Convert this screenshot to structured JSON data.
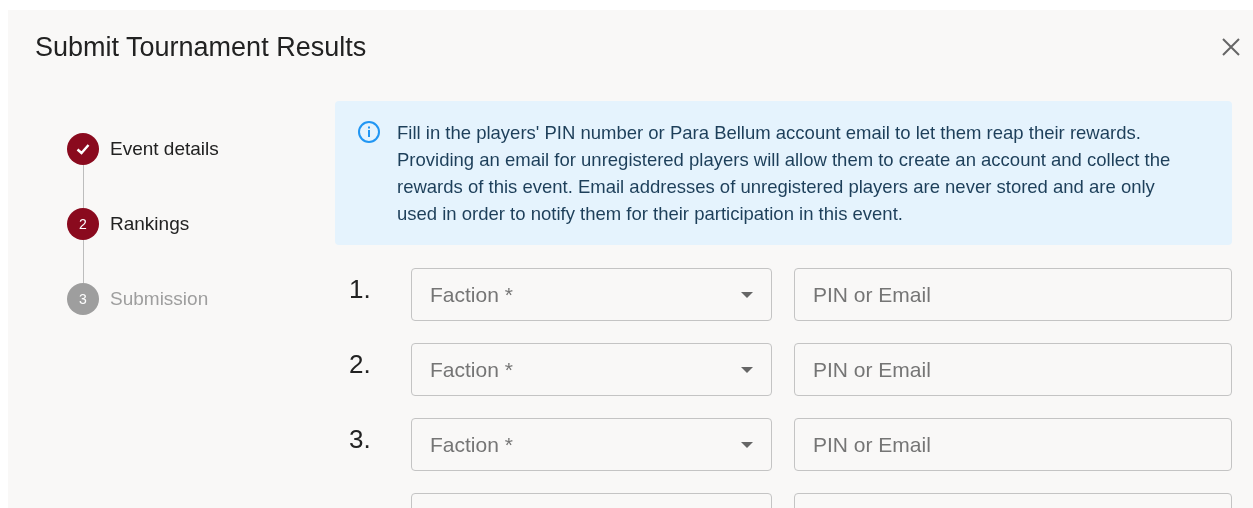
{
  "dialog": {
    "title": "Submit Tournament Results"
  },
  "steps": [
    {
      "label": "Event details",
      "completed": true
    },
    {
      "number": "2",
      "label": "Rankings",
      "completed": false,
      "active": true
    },
    {
      "number": "3",
      "label": "Submission",
      "completed": false,
      "active": false
    }
  ],
  "info": {
    "text": "Fill in the players' PIN number or Para Bellum account email to let them reap their rewards. Providing an email for unregistered players will allow them to create an account and collect the rewards of this event. Email addresses of unregistered players are never stored and are only used in order to notify them for their participation in this event."
  },
  "rows": [
    {
      "kind": "full",
      "rank": "1.",
      "faction_placeholder": "Faction *",
      "pin_placeholder": "PIN or Email"
    },
    {
      "kind": "full",
      "rank": "2.",
      "faction_placeholder": "Faction *",
      "pin_placeholder": "PIN or Email"
    },
    {
      "kind": "full",
      "rank": "3.",
      "faction_placeholder": "Faction *",
      "pin_placeholder": "PIN or Email"
    },
    {
      "kind": "partial"
    }
  ]
}
